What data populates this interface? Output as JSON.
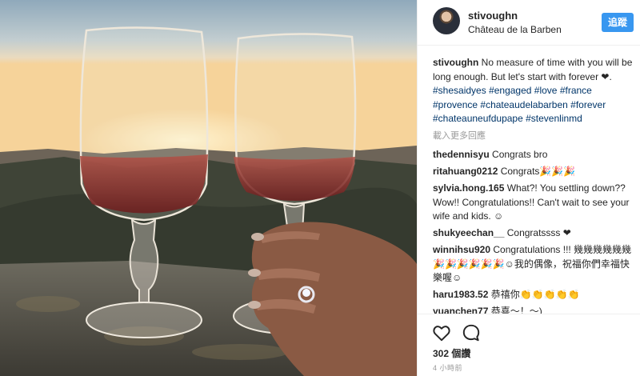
{
  "post": {
    "username": "stivoughn",
    "location": "Château de la Barben",
    "follow_label": "追蹤",
    "caption": {
      "username": "stivoughn",
      "text": " No measure of time with you will be long enough. But let's start with forever ❤.",
      "hashtags": [
        "#shesaidyes",
        "#engaged",
        "#love",
        "#france",
        "#provence",
        "#chateaudelabarben",
        "#forever",
        "#chateauneufdupape",
        "#stevenlinmd"
      ]
    },
    "load_more_label": "載入更多回應",
    "comments": [
      {
        "username": "thedennisyu",
        "text": "Congrats bro"
      },
      {
        "username": "ritahuang0212",
        "text": "Congrats🎉🎉🎉"
      },
      {
        "username": "sylvia.hong.165",
        "text": "What?! You settling down?? Wow!! Congratulations!! Can't wait to see your wife and kids. ☺"
      },
      {
        "username": "shukyeechan__",
        "text": "Congratssss ❤"
      },
      {
        "username": "winnihsu920",
        "text": "Congratulations !!! 幾幾幾幾幾幾🎉🎉🎉🎉🎉🎉☺我的偶像，祝福你們幸福快樂喔☺"
      },
      {
        "username": "haru1983.52",
        "text": "恭禧你👏👏👏👏👏"
      },
      {
        "username": "yuanchen77",
        "text": "恭喜～！～)"
      }
    ],
    "likes_label": "302 個讚",
    "time_label": "4 小時前"
  },
  "icons": {
    "like": "heart-outline-icon",
    "comment": "speech-bubble-icon"
  },
  "colors": {
    "follow_button": "#3897f0",
    "hashtag": "#003569",
    "muted": "#999999"
  }
}
